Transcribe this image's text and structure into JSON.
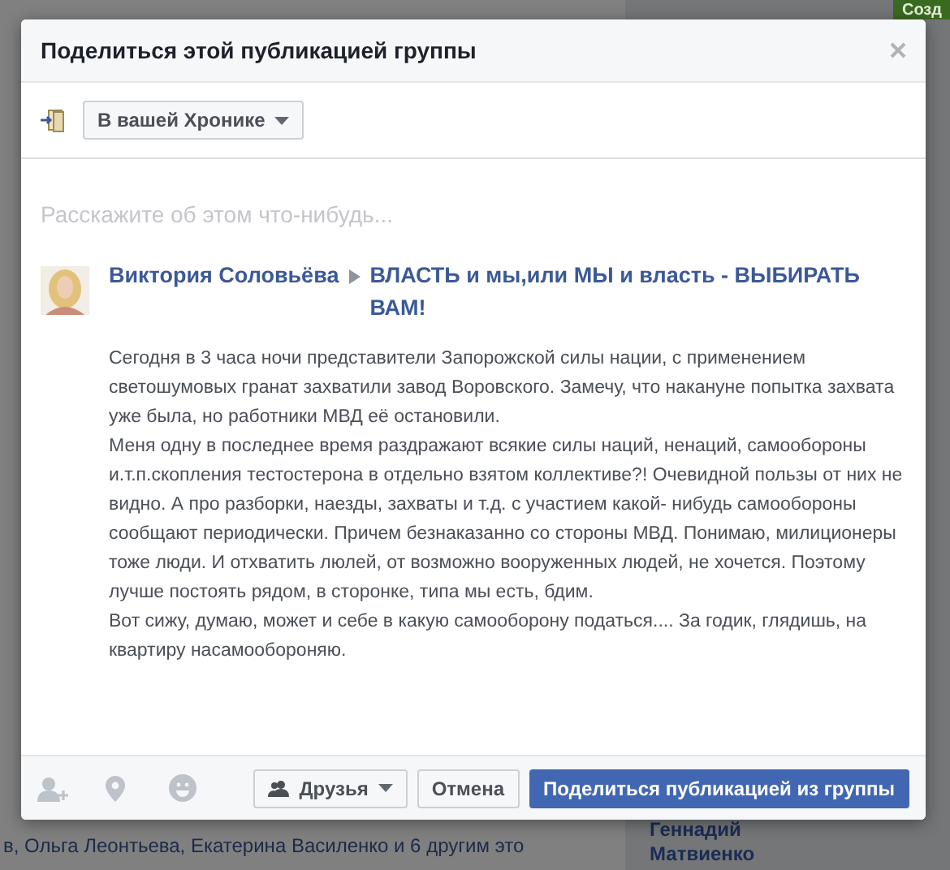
{
  "background": {
    "side_button": "Созд",
    "bottom_text": "в, Ольга Леонтьева, Екатерина Василенко и 6 другим это",
    "suggestion_name": "Геннадий Матвиенко"
  },
  "dialog": {
    "title": "Поделиться этой публикацией группы",
    "audience_select": "В вашей Хронике",
    "comment": {
      "placeholder": "Расскажите об этом что-нибудь..."
    },
    "post": {
      "author": "Виктория Соловьёва",
      "group": "ВЛАСТЬ и мы,или МЫ и власть - ВЫБИРАТЬ ВАМ!",
      "paragraphs": [
        "Сегодня в 3 часа ночи представители Запорожской силы нации, с применением светошумовых гранат захватили завод Воровского. Замечу, что накануне попытка захвата уже была, но работники МВД её остановили.",
        "Меня одну в последнее время раздражают всякие силы наций, ненаций, самообороны и.т.п.скопления тестостерона в отдельно взятом коллективе?! Очевидной пользы от них не видно. А про разборки, наезды, захваты и т.д. с участием какой- нибудь самообороны сообщают периодически. Причем безнаказанно со стороны МВД. Понимаю, милиционеры тоже люди. И отхватить люлей, от возможно вооруженных людей, не хочется. Поэтому лучше постоять рядом, в сторонке, типа мы есть, бдим.",
        "Вот сижу, думаю, может и себе в какую самооборону податься.... За годик, глядишь, на квартиру насамообороняю."
      ]
    },
    "privacy": "Друзья",
    "cancel": "Отмена",
    "share": "Поделиться публикацией из группы"
  }
}
